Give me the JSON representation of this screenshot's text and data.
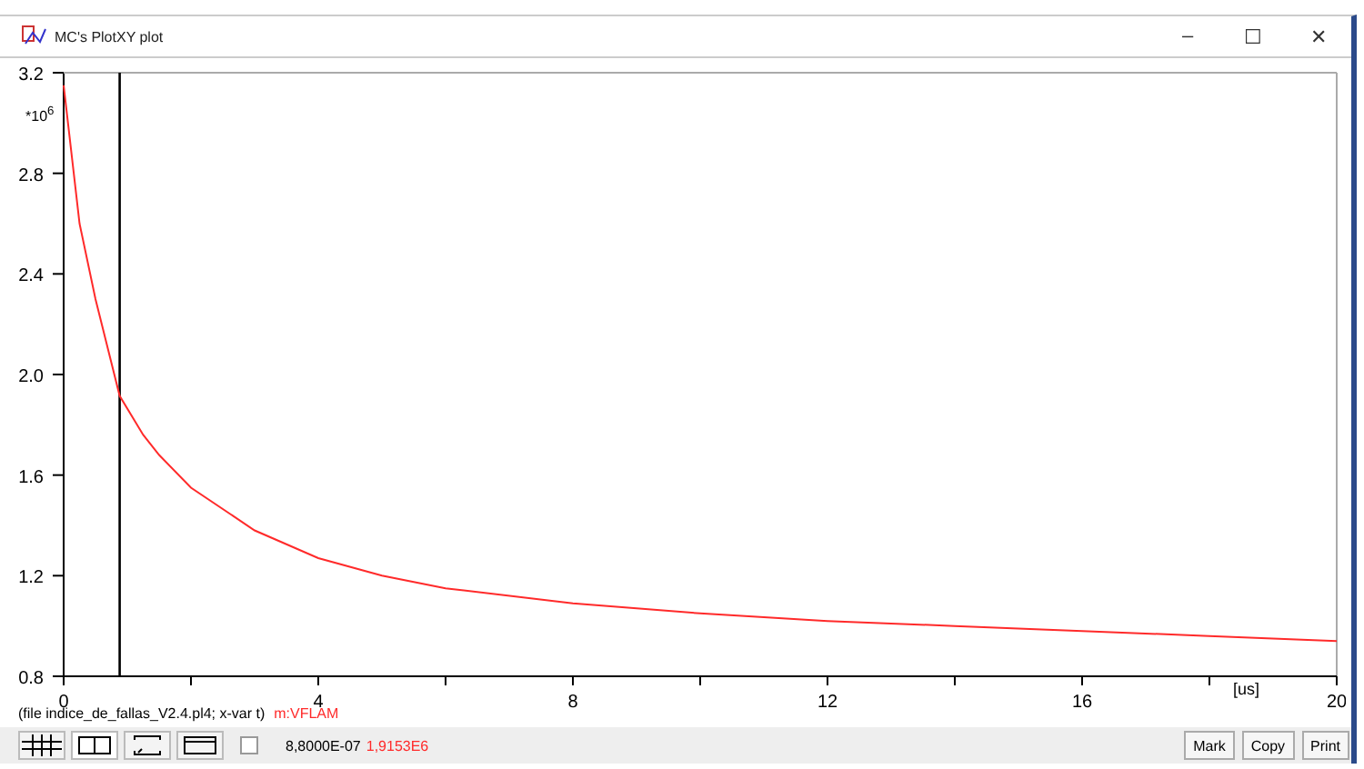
{
  "window": {
    "title": "MC's PlotXY plot",
    "controls": [
      "–",
      "☐",
      "✕"
    ]
  },
  "plot": {
    "scale_note": "*10$^{6}$",
    "x_unit": "[us]",
    "chart_data": {
      "type": "line",
      "x": [
        0,
        0.25,
        0.5,
        0.88,
        1.25,
        1.5,
        2,
        3,
        4,
        5,
        6,
        8,
        10,
        12,
        14,
        16,
        18,
        20
      ],
      "series": [
        {
          "name": "m:VFLAM",
          "color": "#ff2a2a",
          "values": [
            3.15,
            2.6,
            2.3,
            1.915,
            1.76,
            1.68,
            1.55,
            1.38,
            1.27,
            1.2,
            1.15,
            1.09,
            1.05,
            1.02,
            1.0,
            0.98,
            0.96,
            0.94
          ]
        }
      ],
      "xlim": [
        0,
        20
      ],
      "ylim": [
        0.8,
        3.2
      ],
      "xticks": [
        0,
        4,
        8,
        12,
        16,
        20
      ],
      "yticks": [
        0.8,
        1.2,
        1.6,
        {
          "value": 2,
          "label": "2.0"
        },
        2.4,
        2.8,
        3.2
      ],
      "ref_lines": [
        {
          "axis": "x",
          "value": 0.88,
          "color": "#000000"
        }
      ]
    }
  },
  "file_info": "(file indice_de_fallas_V2.4.pl4; x-var t)",
  "toolbar": {
    "checked": false,
    "x_readout": "8,8000E-07",
    "y_readout": "1,9153E6",
    "buttons": [
      "Mark",
      "Copy",
      "Print"
    ]
  }
}
